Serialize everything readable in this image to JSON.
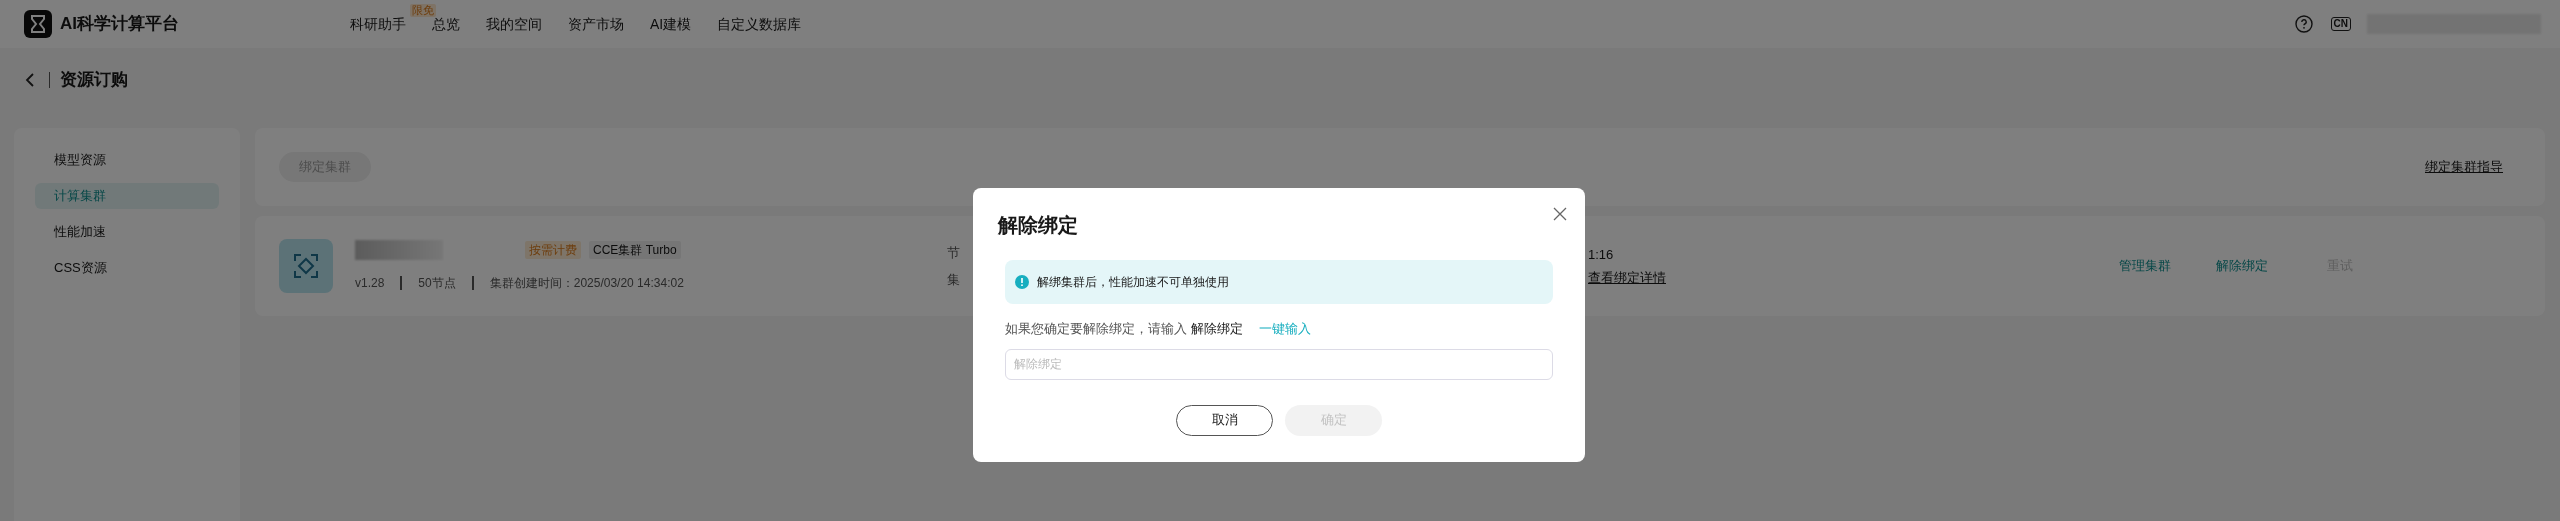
{
  "top_bar": {
    "logo_text": "AI科学计算平台",
    "nav": [
      {
        "label": "科研助手",
        "badge": "限免"
      },
      {
        "label": "总览"
      },
      {
        "label": "我的空间"
      },
      {
        "label": "资产市场"
      },
      {
        "label": "AI建模"
      },
      {
        "label": "自定义数据库"
      }
    ],
    "language_badge": "CN"
  },
  "breadcrumb": {
    "title": "资源订购"
  },
  "sidebar": {
    "items": [
      {
        "label": "模型资源",
        "selected": false
      },
      {
        "label": "计算集群",
        "selected": true
      },
      {
        "label": "性能加速",
        "selected": false
      },
      {
        "label": "CSS资源",
        "selected": false
      }
    ]
  },
  "toolbar": {
    "bind_button": {
      "label": "绑定集群",
      "disabled": true
    },
    "guide_link": "绑定集群指导"
  },
  "cluster_card": {
    "tags": [
      {
        "label": "按需计费",
        "kind": "billing"
      },
      {
        "label": "CCE集群 Turbo",
        "kind": "type"
      }
    ],
    "version": "v1.28",
    "nodes": "50节点",
    "created": "集群创建时间：2025/03/20 14:34:02",
    "column_3": [
      "节",
      "集"
    ],
    "column_4": {
      "time": "1:16",
      "link": "查看绑定详情"
    },
    "actions": [
      {
        "label": "管理集群",
        "disabled": false
      },
      {
        "label": "解除绑定",
        "disabled": false
      },
      {
        "label": "重试",
        "disabled": true
      }
    ]
  },
  "dialog": {
    "title": "解除绑定",
    "notice": "解绑集群后，性能加速不可单独使用",
    "prompt": "如果您确定要解除绑定，请输入 **解除绑定**",
    "quick_fill_link": "一键输入",
    "input": {
      "placeholder": "解除绑定"
    },
    "buttons": [
      {
        "label": "取消",
        "kind": "secondary",
        "disabled": false
      },
      {
        "label": "确定",
        "kind": "primary",
        "disabled": true
      }
    ]
  }
}
